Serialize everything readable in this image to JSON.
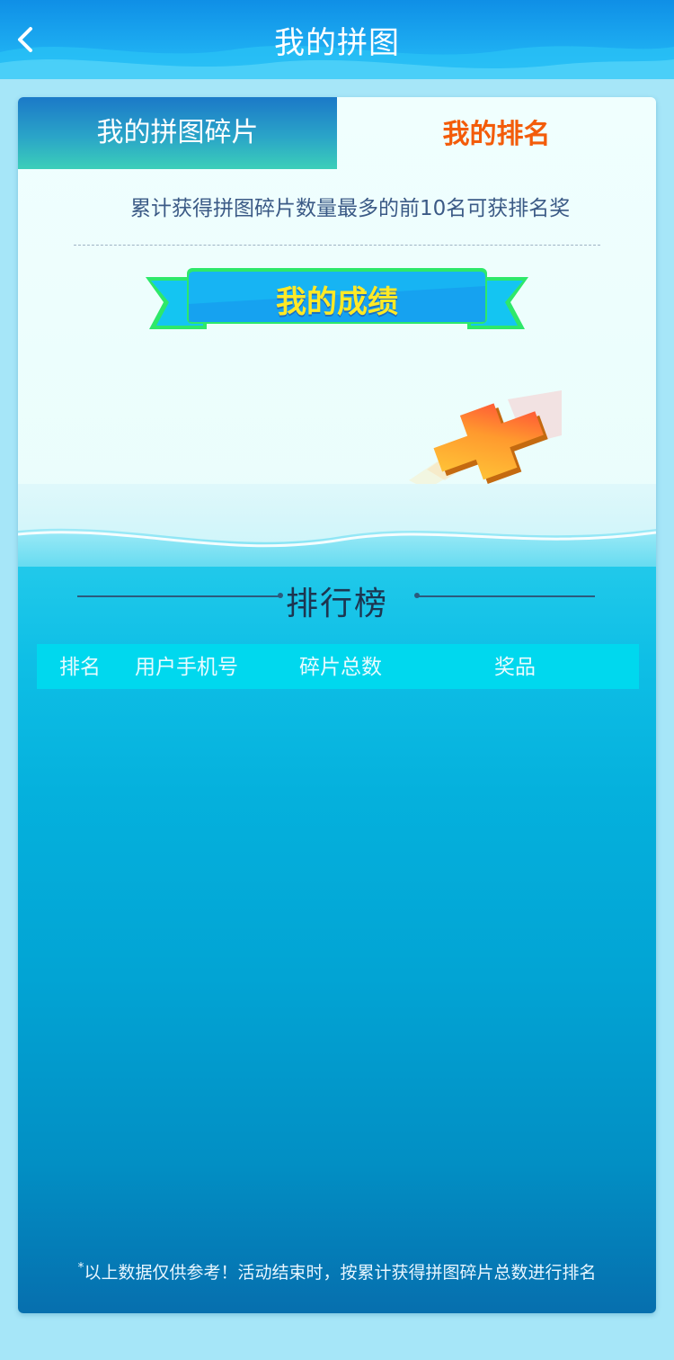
{
  "header": {
    "title": "我的拼图",
    "back_icon": "chevron-left-icon"
  },
  "tabs": [
    {
      "label": "我的拼图碎片",
      "active": false
    },
    {
      "label": "我的排名",
      "active": true
    }
  ],
  "notice": "累计获得拼图碎片数量最多的前10名可获排名奖",
  "ribbon": {
    "label": "我的成绩"
  },
  "leaderboard": {
    "title": "排行榜",
    "columns": [
      "排名",
      "用户手机号",
      "碎片总数",
      "奖品"
    ],
    "rows": []
  },
  "footnote": {
    "mark": "*",
    "text": "以上数据仅供参考！活动结束时，按累计获得拼图碎片总数进行排名"
  },
  "colors": {
    "header_blue": "#1fb1f3",
    "active_tab_text": "#f35c0a",
    "ribbon_text": "#ffe926",
    "table_head_bg": "#00d8ee"
  }
}
